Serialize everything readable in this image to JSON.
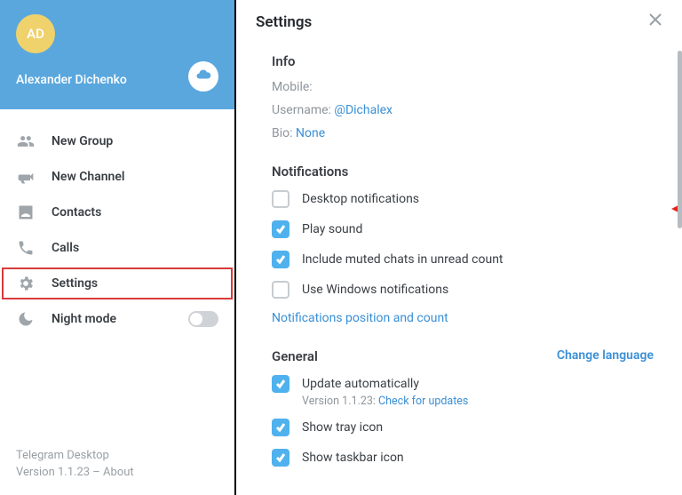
{
  "sidebar": {
    "avatarInitials": "AD",
    "userName": "Alexander Dichenko",
    "items": [
      {
        "label": "New Group"
      },
      {
        "label": "New Channel"
      },
      {
        "label": "Contacts"
      },
      {
        "label": "Calls"
      },
      {
        "label": "Settings"
      },
      {
        "label": "Night mode"
      }
    ],
    "appName": "Telegram Desktop",
    "versionLine": "Version 1.1.23 – ",
    "aboutLabel": "About"
  },
  "panel": {
    "title": "Settings",
    "info": {
      "title": "Info",
      "mobileLabel": "Mobile:",
      "usernameLabel": "Username: ",
      "usernameValue": "@Dichalex",
      "bioLabel": "Bio: ",
      "bioValue": "None"
    },
    "notifications": {
      "title": "Notifications",
      "opts": [
        {
          "label": "Desktop notifications",
          "checked": false
        },
        {
          "label": "Play sound",
          "checked": true
        },
        {
          "label": "Include muted chats in unread count",
          "checked": true
        },
        {
          "label": "Use Windows notifications",
          "checked": false
        }
      ],
      "posLink": "Notifications position and count"
    },
    "general": {
      "title": "General",
      "changeLang": "Change language",
      "opts": [
        {
          "label": "Update automatically",
          "checked": true,
          "subPrefix": "Version 1.1.23: ",
          "subLink": "Check for updates"
        },
        {
          "label": "Show tray icon",
          "checked": true
        },
        {
          "label": "Show taskbar icon",
          "checked": true
        }
      ]
    }
  }
}
